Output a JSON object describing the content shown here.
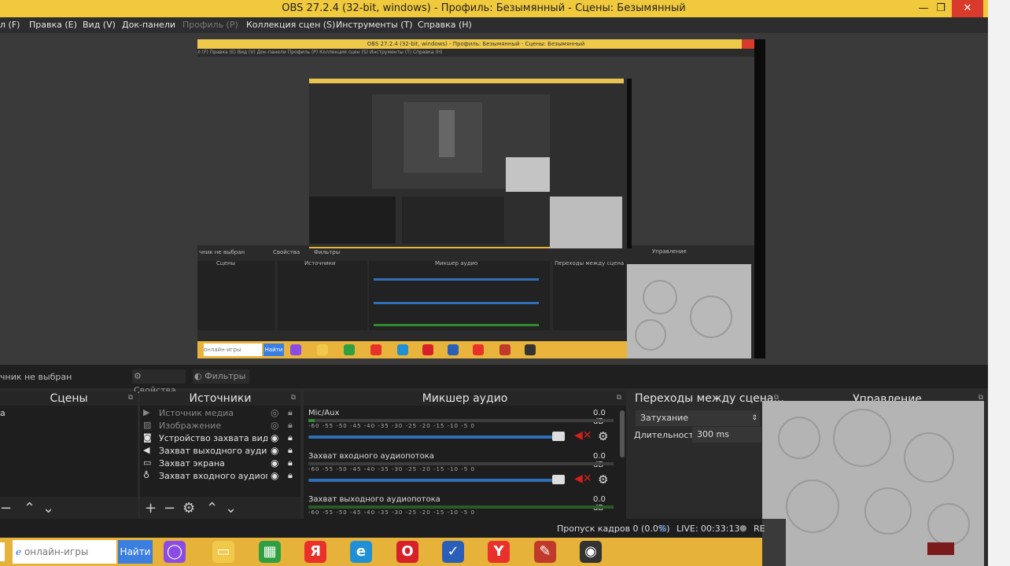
{
  "window": {
    "title": "OBS 27.2.4 (32-bit, windows) - Профиль: Безымянный - Сцены: Безымянный",
    "btn_min": "—",
    "btn_max": "❐",
    "btn_close": "✕"
  },
  "menu": [
    "л (F)",
    "Правка (E)",
    "Вид (V)",
    "Док-панели",
    "Профиль (P)",
    "Коллекция сцен (S)",
    "Инструменты (T)",
    "Справка (H)"
  ],
  "dockstrip": {
    "source_none": "чник не выбран",
    "properties": "Свойства",
    "filters": "Фильтры"
  },
  "scenes": {
    "header": "Сцены",
    "items": [
      "а"
    ]
  },
  "sources": {
    "header": "Источники",
    "items": [
      {
        "label": "Источник медиа",
        "icon": "play-icon",
        "visible": false
      },
      {
        "label": "Изображение",
        "icon": "image-icon",
        "visible": false
      },
      {
        "label": "Устройство захвата видео",
        "icon": "camera-icon",
        "visible": true
      },
      {
        "label": "Захват выходного аудиопот",
        "icon": "speaker-icon",
        "visible": true
      },
      {
        "label": "Захват экрана",
        "icon": "monitor-icon",
        "visible": true
      },
      {
        "label": "Захват входного аудиопото",
        "icon": "mic-icon",
        "visible": true
      }
    ]
  },
  "mixer": {
    "header": "Микшер аудио",
    "ticks": "-60 -55 -50 -45 -40 -35 -30 -25 -20 -15 -10 -5 0",
    "channels": [
      {
        "name": "Mic/Aux",
        "db": "0.0 dB",
        "level": 0.02
      },
      {
        "name": "Захват входного аудиопотока",
        "db": "0.0 dB",
        "level": 0.0
      },
      {
        "name": "Захват выходного аудиопотока",
        "db": "0.0 dB",
        "level": 0.0
      }
    ]
  },
  "transitions": {
    "header": "Переходы между сцена...",
    "selected": "Затухание",
    "duration_label": "Длительность",
    "duration_value": "300 ms"
  },
  "controls": {
    "header": "Управление"
  },
  "status": {
    "dropped": "Пропуск кадров 0 (0.0%)",
    "live": "LIVE: 00:33:13",
    "rec": "RE"
  },
  "taskbar": {
    "search_text": "онлайн-игры",
    "search_button": "Найти",
    "apps": [
      {
        "name": "alice",
        "color": "#8a4be6",
        "glyph": "◯"
      },
      {
        "name": "explorer",
        "color": "#f2c84b",
        "glyph": "▭"
      },
      {
        "name": "store",
        "color": "#2ea043",
        "glyph": "▦"
      },
      {
        "name": "yandex",
        "color": "#e8312a",
        "glyph": "Я"
      },
      {
        "name": "edge",
        "color": "#1f8fd6",
        "glyph": "e"
      },
      {
        "name": "opera",
        "color": "#d6202a",
        "glyph": "O"
      },
      {
        "name": "defender",
        "color": "#2a5fb8",
        "glyph": "✓"
      },
      {
        "name": "yandex-browser",
        "color": "#e8312a",
        "glyph": "Y"
      },
      {
        "name": "game",
        "color": "#c0392b",
        "glyph": "✎"
      },
      {
        "name": "obs",
        "color": "#333333",
        "glyph": "◉"
      }
    ]
  },
  "nested": {
    "title": "OBS 27.2.4 (32-bit, windows) - Профиль: Безымянный - Сцены: Безымянный",
    "menu": "л (F)   Правка (E)   Вид (V)   Док-панели   Профиль (P)   Коллекция сцен (S)   Инструменты (T)   Справка (H)",
    "src_none": "чник не выбран",
    "props": "Свойства",
    "filters": "Фильтры",
    "docks": [
      "Сцены",
      "Источники",
      "Микшер аудио",
      "Переходы между сцена",
      "Управление"
    ],
    "search_text": "онлайн-игры",
    "search_button": "Найти"
  }
}
